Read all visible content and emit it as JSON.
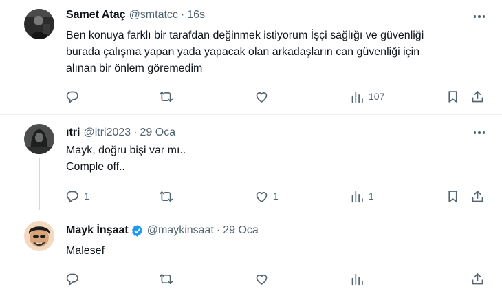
{
  "tweets": [
    {
      "name": "Samet Ataç",
      "handle": "@smtatcc",
      "separator": "·",
      "time": "16s",
      "lines": [
        "Ben konuya farklı bir tarafdan değinmek istiyorum İşçi sağlığı ve güvenliği",
        "burada çalışma yapan yada yapacak olan arkadaşların can güvenliği için",
        "alınan bir önlem göremedim"
      ],
      "reply_count": "",
      "retweet_count": "",
      "like_count": "",
      "view_count": "107"
    },
    {
      "name": "ıtri",
      "handle": "@itri2023",
      "separator": "·",
      "time": "29 Oca",
      "lines": [
        "Mayk, doğru bişi var mı..",
        "Comple off.."
      ],
      "reply_count": "1",
      "retweet_count": "",
      "like_count": "1",
      "view_count": "1"
    },
    {
      "name": "Mayk İnşaat",
      "verified": true,
      "handle": "@maykinsaat",
      "separator": "·",
      "time": "29 Oca",
      "lines": [
        "Malesef"
      ],
      "reply_count": "",
      "retweet_count": "",
      "like_count": "",
      "view_count": ""
    }
  ],
  "colors": {
    "text_primary": "#0f1419",
    "text_secondary": "#536471",
    "verified_blue": "#1d9bf0",
    "divider": "#eff3f4",
    "thread_line": "#cfd9de"
  },
  "icons": [
    "reply-icon",
    "retweet-icon",
    "like-icon",
    "views-icon",
    "bookmark-icon",
    "share-icon",
    "more-icon",
    "verified-badge-icon"
  ]
}
